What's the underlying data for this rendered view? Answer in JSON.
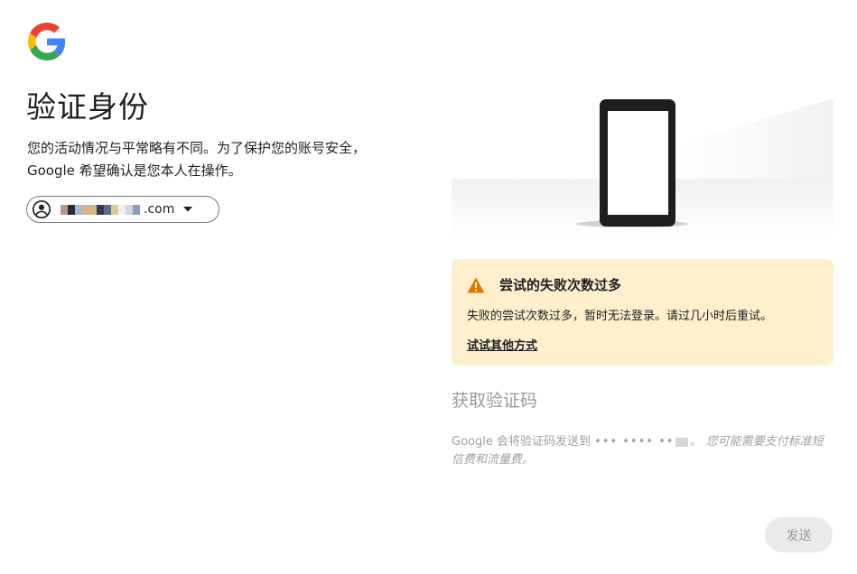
{
  "header": {
    "logo": "google-g-logo"
  },
  "page": {
    "title": "验证身份",
    "description_line1": "您的活动情况与平常略有不同。为了保护您的账号安全，",
    "description_line2": "Google 希望确认是您本人在操作。"
  },
  "account": {
    "icon": "account-circle-icon",
    "email_domain": ".com",
    "dropdown_icon": "arrow-drop-down-icon"
  },
  "warning": {
    "icon": "warning-triangle-icon",
    "title": "尝试的失败次数过多",
    "body": "失败的尝试次数过多，暂时无法登录。请过几小时后重试。",
    "link": "试试其他方式",
    "background": "#fef0cd",
    "icon_color": "#e37400"
  },
  "verification": {
    "title": "获取验证码",
    "note_prefix": "Google 会将验证码发送到",
    "masked_phone": "••• •••• ••",
    "note_suffix": "。",
    "note_italic": "您可能需要支付标准短信费和流量费。"
  },
  "actions": {
    "send_label": "发送"
  }
}
